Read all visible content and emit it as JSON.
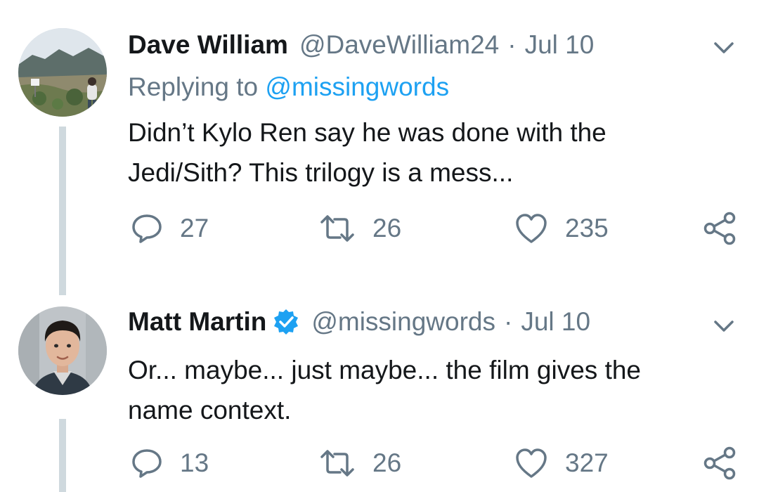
{
  "tweets": [
    {
      "author_name": "Dave William",
      "handle": "@DaveWilliam24",
      "separator": "·",
      "date": "Jul 10",
      "verified": false,
      "reply_prefix": "Replying to",
      "reply_mention": "@missingwords",
      "text_lines": [
        "Didn’t Kylo Ren say he was done with the",
        "Jedi/Sith? This trilogy is a mess..."
      ],
      "replies": "27",
      "retweets": "26",
      "likes": "235",
      "avatar": "landscape-photo-avatar"
    },
    {
      "author_name": "Matt Martin",
      "handle": "@missingwords",
      "separator": "·",
      "date": "Jul 10",
      "verified": true,
      "text_lines": [
        "Or... maybe... just maybe... the film gives the",
        "name context."
      ],
      "replies": "13",
      "retweets": "26",
      "likes": "327",
      "avatar": "portrait-photo-avatar"
    }
  ],
  "icons": {
    "reply": "speech-bubble-icon",
    "retweet": "retweet-arrows-icon",
    "like": "heart-outline-icon",
    "share": "share-nodes-icon",
    "menu": "chevron-down-icon",
    "verified": "verified-badge-icon"
  },
  "colors": {
    "text": "#14171a",
    "muted": "#657786",
    "link": "#1da1f2",
    "thread_line": "#cfd9de"
  }
}
